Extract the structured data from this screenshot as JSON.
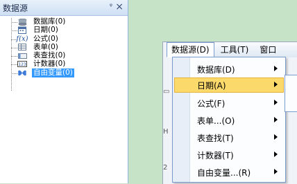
{
  "panel": {
    "title": "数据源",
    "pin_glyph": "⼓",
    "close_glyph": "×",
    "items": [
      {
        "label": "数据库(0)",
        "icon": "database-icon",
        "glyph": "▦"
      },
      {
        "label": "日期(0)",
        "icon": "calendar-icon",
        "glyph": "▤"
      },
      {
        "label": "公式(0)",
        "icon": "formula-icon",
        "glyph": "f"
      },
      {
        "label": "表单(0)",
        "icon": "table-icon",
        "glyph": "▦"
      },
      {
        "label": "表查找(0)",
        "icon": "table-lookup-icon",
        "glyph": "▭"
      },
      {
        "label": "计数器(0)",
        "icon": "counter-icon",
        "glyph": "▣"
      },
      {
        "label": "自由变量(0)",
        "icon": "variable-icon",
        "glyph": "✣"
      }
    ]
  },
  "menubar": {
    "items": [
      "数据源(D)",
      "工具(T)",
      "窗口"
    ]
  },
  "dropdown": {
    "items": [
      {
        "label": "数据库(D)"
      },
      {
        "label": "日期(A)"
      },
      {
        "label": "公式(F)"
      },
      {
        "label": "表单...(O)"
      },
      {
        "label": "表查找(T)"
      },
      {
        "label": "计数器(T)"
      },
      {
        "label": "自由变量...(R)"
      }
    ]
  },
  "colors": {
    "desktop_bg": "#c7e3c7",
    "selection_bg": "#3399ff",
    "menu_highlight": "#fcd96b",
    "menu_border": "#7a9bcd"
  }
}
